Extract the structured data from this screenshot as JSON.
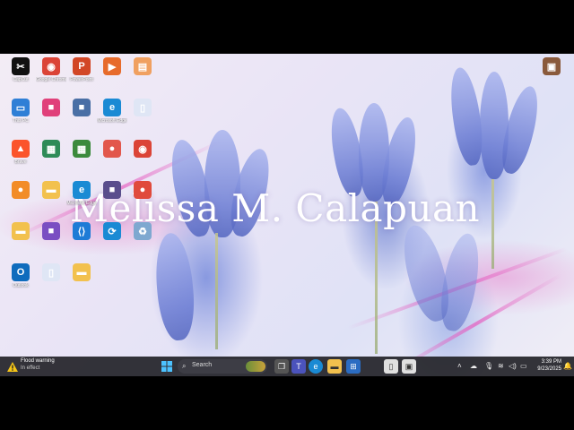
{
  "wallpaper": {
    "watermark_text": "Melissa M. Calapuan",
    "theme_colors": [
      "#e9e4f6",
      "#6d7ed4",
      "#e65abe"
    ]
  },
  "desktop_icons": [
    {
      "name": "capcut-icon",
      "label": "CapCut",
      "color": "#111111",
      "glyph": "✂"
    },
    {
      "name": "chrome-icon",
      "label": "Google Chrome",
      "color": "#db4437",
      "glyph": "◉"
    },
    {
      "name": "powerpoint-icon",
      "label": "PowerPoint",
      "color": "#d24726",
      "glyph": "P"
    },
    {
      "name": "media-player-icon",
      "label": "",
      "color": "#e76b2b",
      "glyph": "▶"
    },
    {
      "name": "shortcut-icon",
      "label": "",
      "color": "#f0a060",
      "glyph": "▤"
    },
    {
      "name": "this-pc-icon",
      "label": "This PC",
      "color": "#2f7fd6",
      "glyph": "▭"
    },
    {
      "name": "app-icon",
      "label": "",
      "color": "#e0407a",
      "glyph": "■"
    },
    {
      "name": "app-icon-2",
      "label": "",
      "color": "#4a6fa5",
      "glyph": "■"
    },
    {
      "name": "edge-icon",
      "label": "Microsoft Edge",
      "color": "#1a8ad4",
      "glyph": "e"
    },
    {
      "name": "file-icon",
      "label": "",
      "color": "#dfe6f5",
      "glyph": "▯"
    },
    {
      "name": "brave-icon",
      "label": "Brave",
      "color": "#fb542b",
      "glyph": "▲"
    },
    {
      "name": "app-icon-3",
      "label": "",
      "color": "#2e8b57",
      "glyph": "▦"
    },
    {
      "name": "app-icon-4",
      "label": "",
      "color": "#3c8a3c",
      "glyph": "▦"
    },
    {
      "name": "app-icon-5",
      "label": "",
      "color": "#e2574c",
      "glyph": "●"
    },
    {
      "name": "chrome-icon-2",
      "label": "",
      "color": "#db4437",
      "glyph": "◉"
    },
    {
      "name": "app-icon-6",
      "label": "",
      "color": "#f28c28",
      "glyph": "●"
    },
    {
      "name": "folder-icon",
      "label": "",
      "color": "#f2c14e",
      "glyph": "▬"
    },
    {
      "name": "edge-icon-2",
      "label": "Microsoft Edge",
      "color": "#1a8ad4",
      "glyph": "e"
    },
    {
      "name": "app-icon-7",
      "label": "",
      "color": "#5a4e8c",
      "glyph": "■"
    },
    {
      "name": "app-icon-8",
      "label": "",
      "color": "#e04a3c",
      "glyph": "●"
    },
    {
      "name": "folder-icon-2",
      "label": "",
      "color": "#f2c14e",
      "glyph": "▬"
    },
    {
      "name": "app-icon-9",
      "label": "",
      "color": "#7a4ec2",
      "glyph": "■"
    },
    {
      "name": "vscode-icon",
      "label": "",
      "color": "#1e7bd6",
      "glyph": "⟨⟩"
    },
    {
      "name": "app-icon-10",
      "label": "",
      "color": "#1a8ad4",
      "glyph": "⟳"
    },
    {
      "name": "recycle-bin-icon",
      "label": "",
      "color": "#7fa8d0",
      "glyph": "♻"
    },
    {
      "name": "outlook-icon",
      "label": "Outlook",
      "color": "#0f6cbd",
      "glyph": "O"
    },
    {
      "name": "file-icon-2",
      "label": "",
      "color": "#dfe6f5",
      "glyph": "▯"
    },
    {
      "name": "folder-icon-3",
      "label": "",
      "color": "#f2c14e",
      "glyph": "▬"
    },
    {
      "name": "user-file-icon",
      "label": "",
      "color": "#8a5a3c",
      "glyph": "▣"
    }
  ],
  "taskbar": {
    "weather_line1": "Flood warning",
    "weather_line2": "In effect",
    "search_label": "Search",
    "time": "3:39 PM",
    "date": "9/23/2025"
  }
}
